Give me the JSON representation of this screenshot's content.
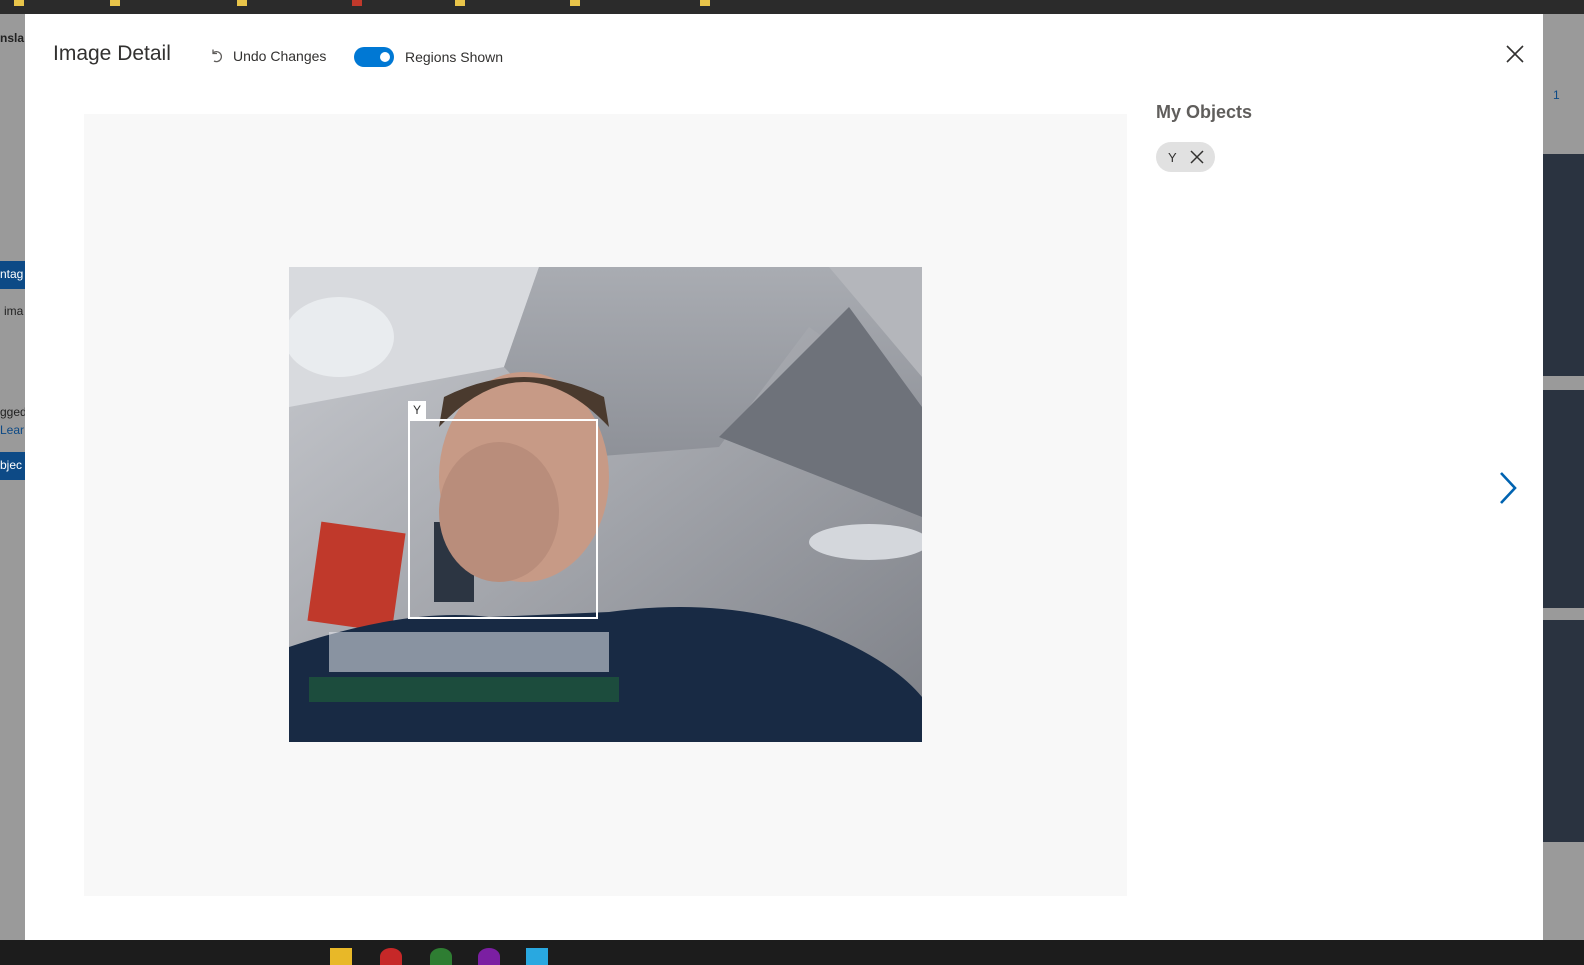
{
  "modal": {
    "title": "Image Detail",
    "undo_label": "Undo Changes",
    "toggle_label": "Regions Shown",
    "toggle_on": true,
    "accent_color": "#0078d4",
    "close_icon": "close-icon",
    "next_icon": "chevron-right-icon"
  },
  "image": {
    "region_tag": "Y"
  },
  "sidebar": {
    "title": "My Objects",
    "tags": [
      {
        "label": "Y",
        "remove_icon": "close-icon"
      }
    ]
  },
  "background": {
    "left_texts": [
      "nsla",
      "ntag",
      "ima",
      "gged",
      "Lear",
      "bjec"
    ],
    "right_text": "1"
  }
}
